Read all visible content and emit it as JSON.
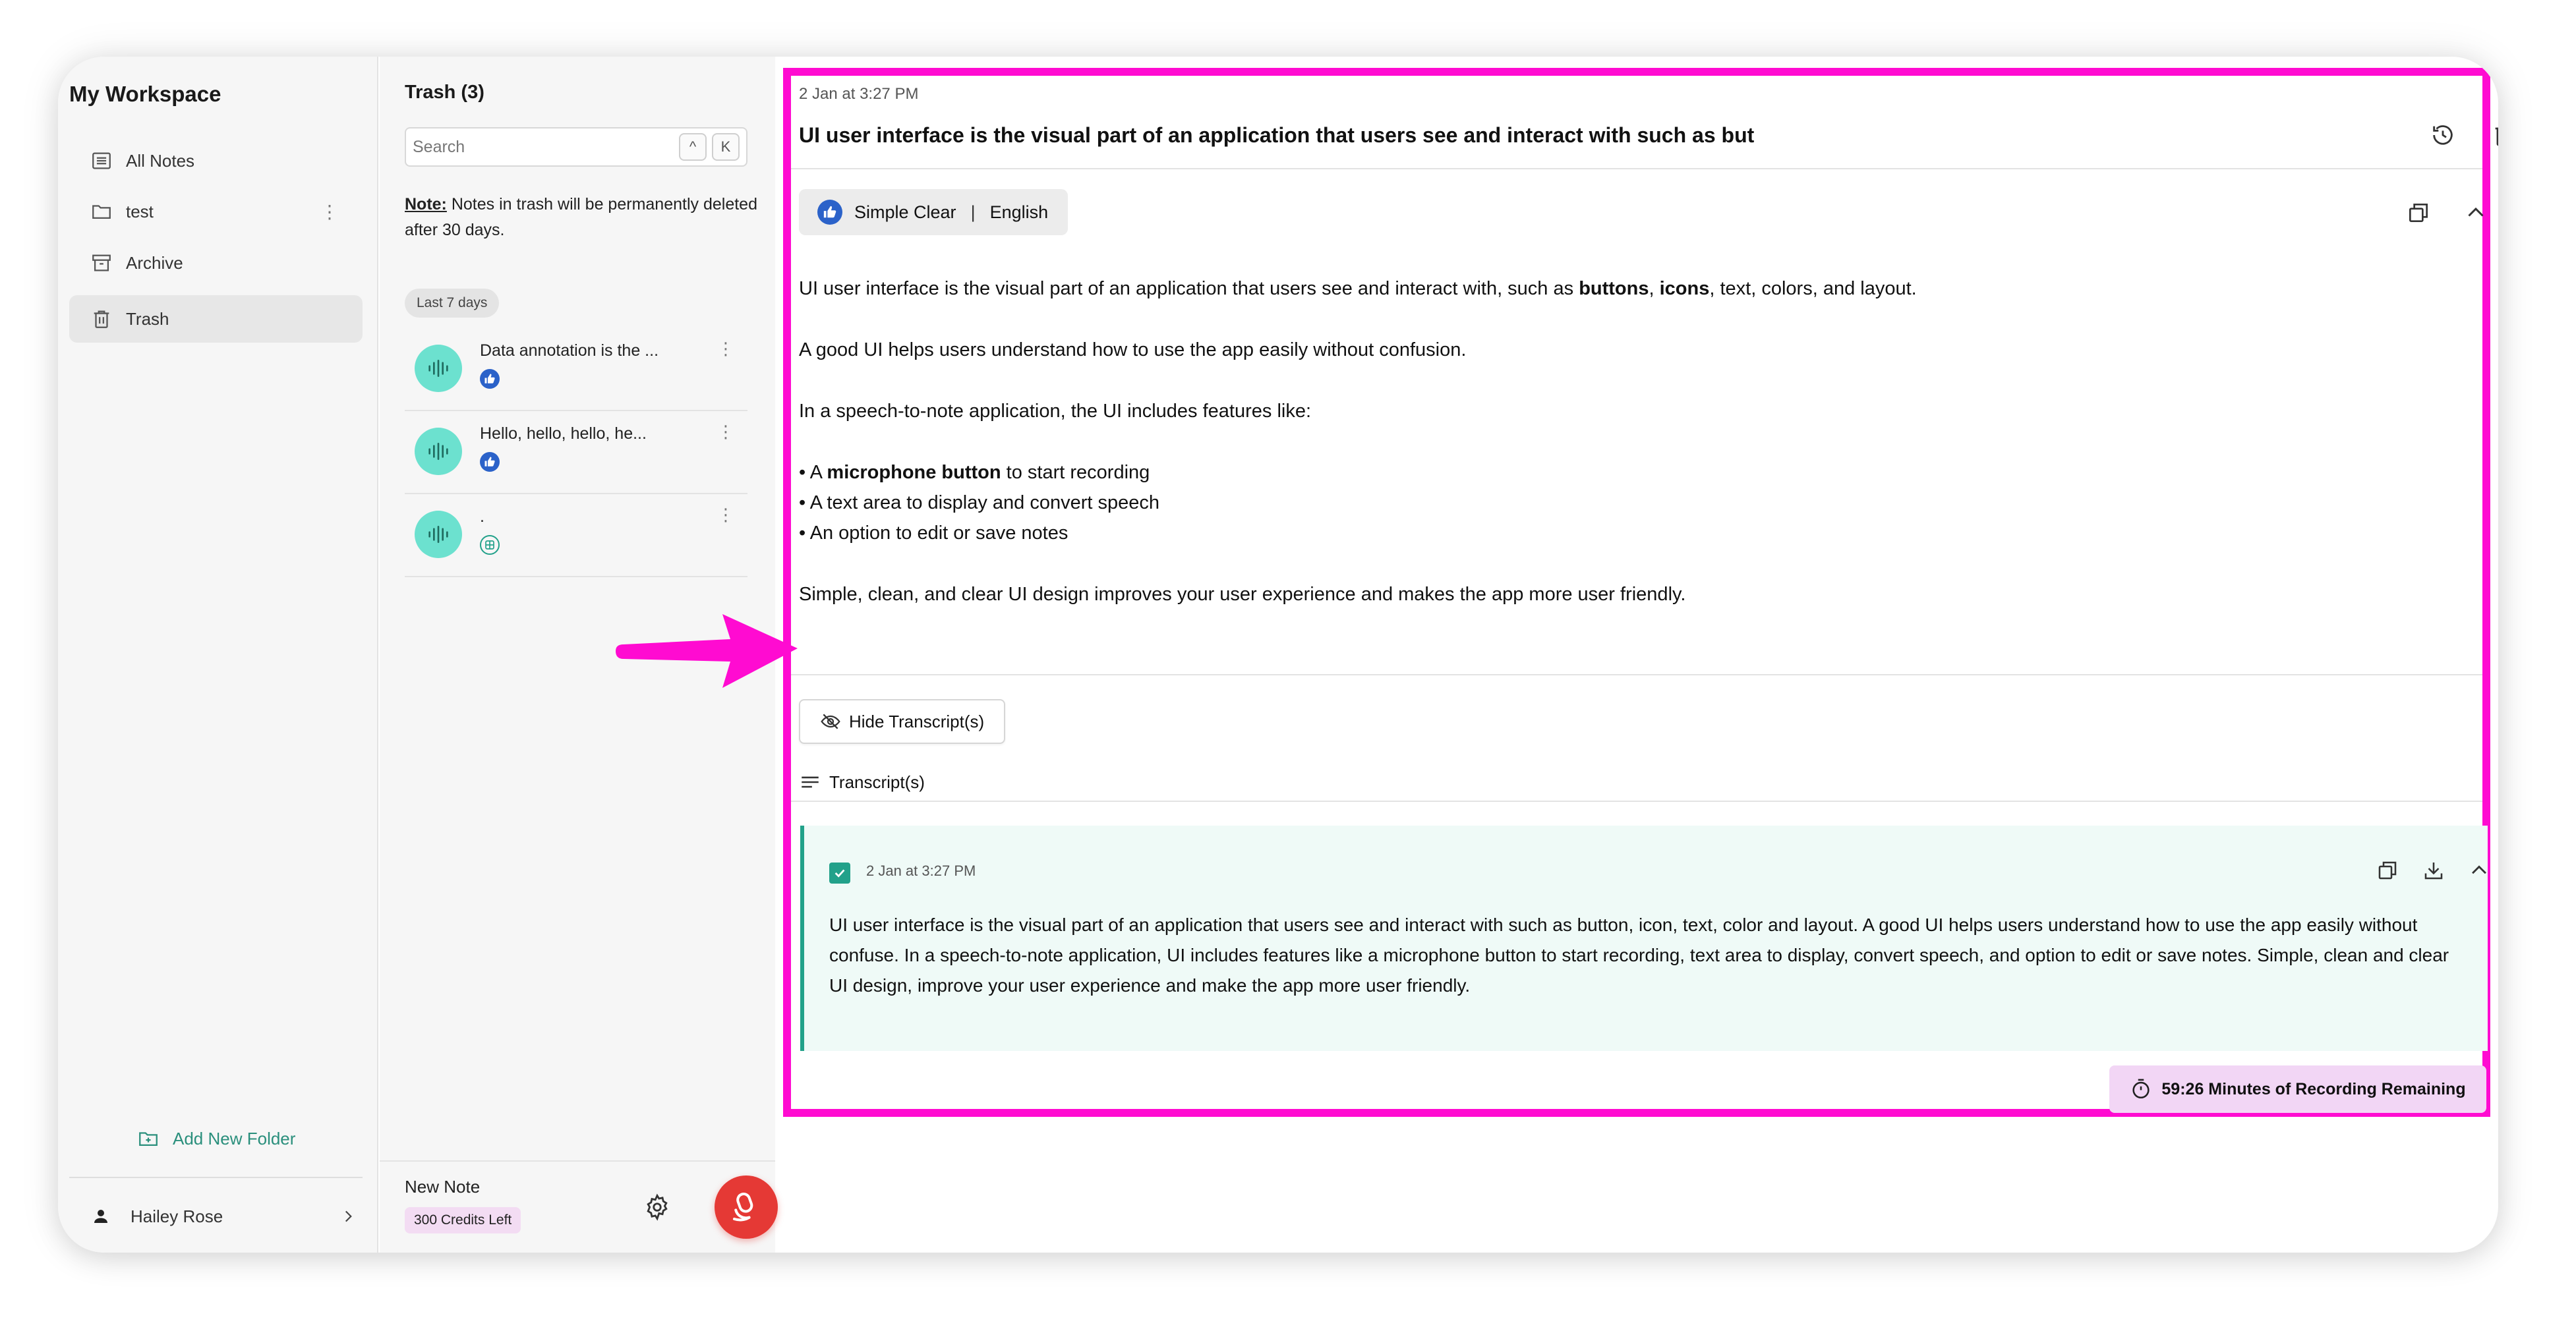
{
  "sidebar": {
    "workspace_title": "My Workspace",
    "items": [
      {
        "label": "All Notes"
      },
      {
        "label": "test"
      },
      {
        "label": "Archive"
      },
      {
        "label": "Trash"
      }
    ],
    "add_folder_label": "Add New Folder",
    "user_name": "Hailey Rose"
  },
  "list": {
    "title": "Trash (3)",
    "search_placeholder": "Search",
    "shortcut_keys": [
      "^",
      "K"
    ],
    "note_prefix": "Note:",
    "note_text": " Notes in trash will be permanently deleted after 30 days.",
    "group_label": "Last 7 days",
    "notes": [
      {
        "title": "Data annotation is the ...",
        "badge": "like-icon"
      },
      {
        "title": "Hello, hello, hello, he...",
        "badge": "like-icon"
      },
      {
        "title": ".",
        "badge": "grid-icon"
      }
    ],
    "new_note_label": "New Note",
    "credits_label": "300 Credits Left"
  },
  "main": {
    "date": "2 Jan at 3:27 PM",
    "title": "UI user interface is the visual part of an application that users see and interact with such as but",
    "style_name": "Simple Clear",
    "style_sep": "|",
    "language": "English",
    "summary": {
      "p1_a": "UI user interface is the visual part of an application that users see and interact with, such as ",
      "p1_b1": "buttons",
      "p1_c": ", ",
      "p1_b2": "icons",
      "p1_d": ", text, colors, and layout.",
      "p2": "A good UI helps users understand how to use the app easily without confusion.",
      "p3": "In a speech-to-note application, the UI includes features like:",
      "b1_a": "• A ",
      "b1_b": "microphone button",
      "b1_c": " to start recording",
      "b2": "• A text area to display and convert speech",
      "b3": "• An option to edit or save notes",
      "p4": "Simple, clean, and clear UI design improves your user experience and makes the app more user friendly."
    },
    "hide_transcripts_label": "Hide Transcript(s)",
    "transcripts_label": "Transcript(s)",
    "transcript": {
      "date": "2 Jan at 3:27 PM",
      "text": "UI user interface is the visual part of an application that users see and interact with such as button, icon, text, color and layout. A good UI helps users understand how to use the app easily without confuse. In a speech-to-note application, UI includes features like a microphone button to start recording, text area to display, convert speech, and option to edit or save notes. Simple, clean and clear UI design, improve your user experience and make the app more user friendly."
    },
    "recording_remaining": "59:26 Minutes of Recording Remaining"
  },
  "colors": {
    "highlight_border": "#ff0bd1",
    "accent": "#22a18a",
    "avatar": "#6ce1cf",
    "record_button": "#e53935",
    "like_badge": "#2b62c9"
  }
}
